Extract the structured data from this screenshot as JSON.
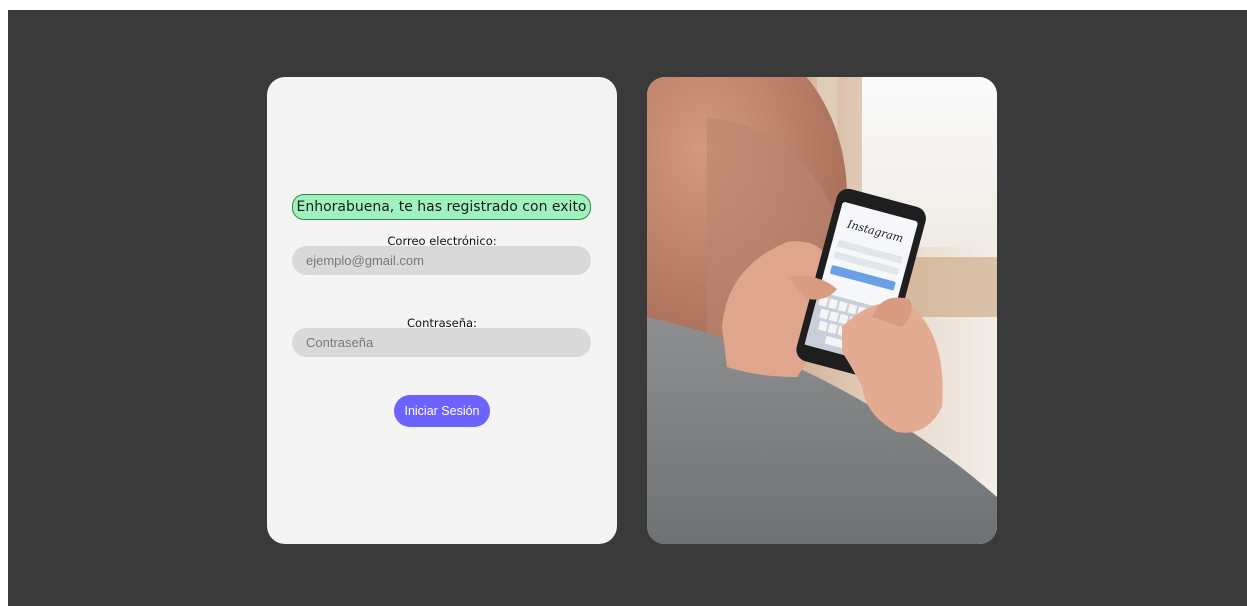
{
  "login": {
    "success_message": "Enhorabuena, te has registrado con exito",
    "email_label": "Correo electrónico:",
    "email_placeholder": "ejemplo@gmail.com",
    "email_value": "",
    "password_label": "Contraseña:",
    "password_placeholder": "Contraseña",
    "password_value": "",
    "submit_label": "Iniciar Sesión"
  },
  "photo": {
    "phone_app_name": "Instagram"
  },
  "colors": {
    "background": "#3a3a3a",
    "card": "#f4f4f4",
    "success_fill": "#9ff2c0",
    "success_border": "#2e8b3a",
    "input_fill": "#d9d9d9",
    "button": "#6c63ff"
  }
}
